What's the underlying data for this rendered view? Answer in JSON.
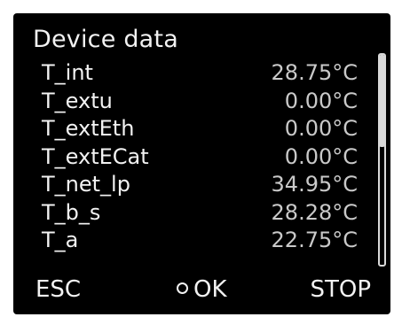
{
  "screen": {
    "title": "Device data"
  },
  "rows": [
    {
      "name": "T_int",
      "value": "28.75°C"
    },
    {
      "name": "T_extu",
      "value": "0.00°C"
    },
    {
      "name": "T_extEth",
      "value": "0.00°C"
    },
    {
      "name": "T_extECat",
      "value": "0.00°C"
    },
    {
      "name": "T_net_lp",
      "value": "34.95°C"
    },
    {
      "name": "T_b_s",
      "value": "28.28°C"
    },
    {
      "name": "T_a",
      "value": "22.75°C"
    }
  ],
  "scroll": {
    "position_fraction": 0.0
  },
  "softkeys": {
    "left": "ESC",
    "center": "OK",
    "right": "STOP"
  },
  "colors": {
    "background": "#000000",
    "text": "#f2f2f2",
    "value_text": "#c9c9c9"
  }
}
